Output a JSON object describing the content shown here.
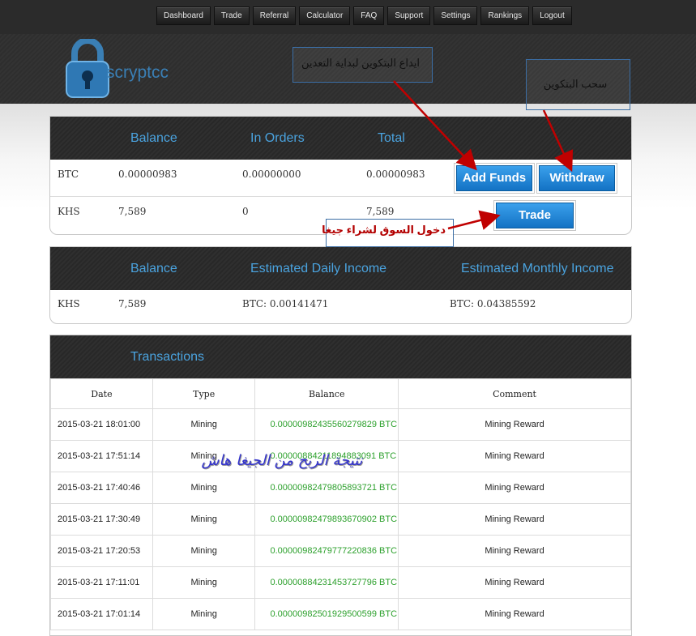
{
  "nav": {
    "items": [
      "Dashboard",
      "Trade",
      "Referral",
      "Calculator",
      "FAQ",
      "Support",
      "Settings",
      "Rankings",
      "Logout"
    ]
  },
  "logo": {
    "text": "scryptcc"
  },
  "balances": {
    "headers": {
      "balance": "Balance",
      "in_orders": "In Orders",
      "total": "Total"
    },
    "rows": [
      {
        "currency": "BTC",
        "balance": "0.00000983",
        "in_orders": "0.00000000",
        "total": "0.00000983"
      },
      {
        "currency": "KHS",
        "balance": "7,589",
        "in_orders": "0",
        "total": "7,589"
      }
    ],
    "add_funds_label": "Add Funds",
    "withdraw_label": "Withdraw",
    "trade_label": "Trade"
  },
  "income": {
    "headers": {
      "balance": "Balance",
      "daily": "Estimated Daily Income",
      "monthly": "Estimated Monthly Income"
    },
    "row": {
      "currency": "KHS",
      "balance": "7,589",
      "daily": "BTC: 0.00141471",
      "monthly": "BTC: 0.04385592"
    }
  },
  "transactions": {
    "title": "Transactions",
    "columns": [
      "Date",
      "Type",
      "Balance",
      "Comment"
    ],
    "rows": [
      {
        "date": "2015-03-21 18:01:00",
        "type": "Mining",
        "balance": "0.0000098243556027982​9 BTC",
        "comment": "Mining Reward"
      },
      {
        "date": "2015-03-21 17:51:14",
        "type": "Mining",
        "balance": "0.00000884211894883091 BTC",
        "comment": "Mining Reward"
      },
      {
        "date": "2015-03-21 17:40:46",
        "type": "Mining",
        "balance": "0.00000982479805893721 BTC",
        "comment": "Mining Reward"
      },
      {
        "date": "2015-03-21 17:30:49",
        "type": "Mining",
        "balance": "0.00000982479893670902 BTC",
        "comment": "Mining Reward"
      },
      {
        "date": "2015-03-21 17:20:53",
        "type": "Mining",
        "balance": "0.00000982479777220836 BTC",
        "comment": "Mining Reward"
      },
      {
        "date": "2015-03-21 17:11:01",
        "type": "Mining",
        "balance": "0.00000884231453727796 BTC",
        "comment": "Mining Reward"
      },
      {
        "date": "2015-03-21 17:01:14",
        "type": "Mining",
        "balance": "0.00000982501929500599 BTC",
        "comment": "Mining Reward"
      }
    ]
  },
  "annotations": {
    "deposit_note": "ايداع البتكوين لبداية التعدين",
    "withdraw_note": "سحب البتكوين",
    "market_note": "دخول السوق لشراء جيغا",
    "profit_note": "نتيجة الربح من الجيغا هاش"
  },
  "colors": {
    "accent_blue": "#4aa3df",
    "button_blue": "#1a7fd4",
    "profit_green": "#2ca02c",
    "arrow_red": "#c00000"
  }
}
